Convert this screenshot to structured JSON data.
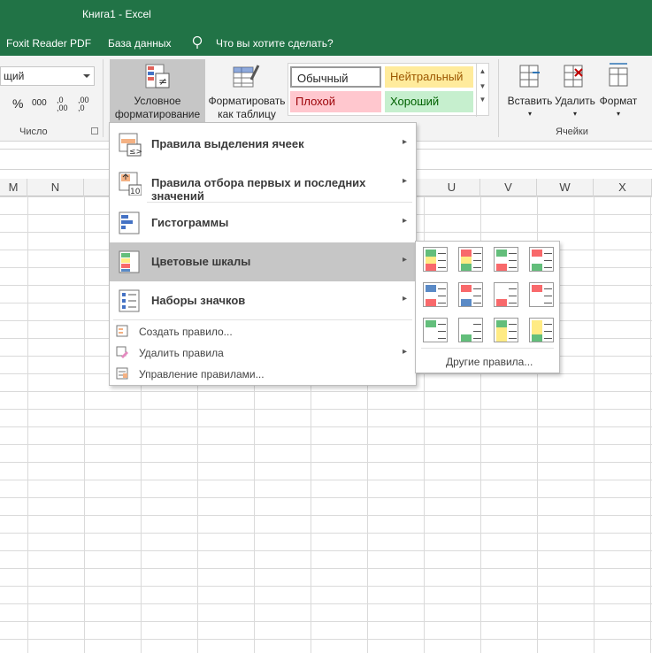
{
  "window": {
    "title": "Книга1  -  Excel"
  },
  "menubar": {
    "items": [
      "Foxit Reader PDF",
      "База данных"
    ],
    "tell_me": "Что вы хотите сделать?"
  },
  "ribbon": {
    "number_format_value": "щий",
    "percent": "%",
    "thousands": "000",
    "inc_decimal": ",0\n,00",
    "dec_decimal": ",00\n,0",
    "group_number": "Число",
    "conditional_formatting": "Условное\nформатирование",
    "format_as_table": "Форматировать\nкак таблицу",
    "styles": {
      "normal": "Обычный",
      "neutral": "Нейтральный",
      "bad": "Плохой",
      "good": "Хороший"
    },
    "insert": "Вставить",
    "delete": "Удалить",
    "format": "Формат",
    "group_cells": "Ячейки"
  },
  "columns": [
    "M",
    "N",
    "U",
    "V",
    "W",
    "X"
  ],
  "cf_menu": {
    "items": [
      {
        "label": "Правила выделения ячеек",
        "icon": "highlight-cells-icon",
        "highlighted": false
      },
      {
        "label": "Правила отбора первых и последних значений",
        "icon": "top-bottom-icon",
        "highlighted": false
      },
      {
        "label": "Гистограммы",
        "icon": "data-bars-icon",
        "highlighted": false
      },
      {
        "label": "Цветовые шкалы",
        "icon": "color-scales-icon",
        "highlighted": true
      },
      {
        "label": "Наборы значков",
        "icon": "icon-sets-icon",
        "highlighted": false
      }
    ],
    "sub_items": [
      {
        "label": "Создать правило...",
        "icon": "new-rule-icon"
      },
      {
        "label": "Удалить правила",
        "icon": "clear-rules-icon"
      },
      {
        "label": "Управление правилами...",
        "icon": "manage-rules-icon"
      }
    ]
  },
  "color_scales": {
    "swatches": [
      [
        "#63be7b",
        "#ffeb84",
        "#f8696b"
      ],
      [
        "#f8696b",
        "#ffeb84",
        "#63be7b"
      ],
      [
        "#63be7b",
        "#ffffff",
        "#f8696b"
      ],
      [
        "#f8696b",
        "#ffffff",
        "#63be7b"
      ],
      [
        "#5a8ac6",
        "#ffffff",
        "#f8696b"
      ],
      [
        "#f8696b",
        "#ffffff",
        "#5a8ac6"
      ],
      [
        "#ffffff",
        "#ffffff",
        "#f8696b"
      ],
      [
        "#f8696b",
        "#ffffff",
        "#ffffff"
      ],
      [
        "#63be7b",
        "#ffffff",
        "#ffffff"
      ],
      [
        "#ffffff",
        "#ffffff",
        "#63be7b"
      ],
      [
        "#63be7b",
        "#ffeb84",
        "#ffeb84"
      ],
      [
        "#ffeb84",
        "#ffeb84",
        "#63be7b"
      ]
    ],
    "more_rules": "Другие правила..."
  },
  "colors": {
    "excel_green": "#217346",
    "menu_highlight": "#c6c6c6",
    "bad_bg": "#ffc7ce",
    "bad_text": "#9c0006",
    "good_bg": "#c6efce",
    "good_text": "#006100",
    "neutral_bg": "#ffeb9c",
    "neutral_text": "#9c5700"
  }
}
